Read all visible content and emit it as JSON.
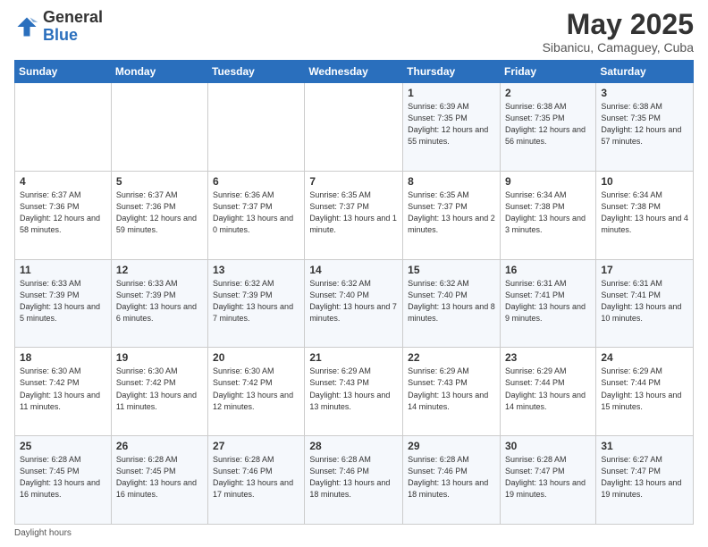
{
  "header": {
    "logo_general": "General",
    "logo_blue": "Blue",
    "month_title": "May 2025",
    "subtitle": "Sibanicu, Camaguey, Cuba"
  },
  "days_of_week": [
    "Sunday",
    "Monday",
    "Tuesday",
    "Wednesday",
    "Thursday",
    "Friday",
    "Saturday"
  ],
  "weeks": [
    [
      {
        "day": "",
        "info": ""
      },
      {
        "day": "",
        "info": ""
      },
      {
        "day": "",
        "info": ""
      },
      {
        "day": "",
        "info": ""
      },
      {
        "day": "1",
        "info": "Sunrise: 6:39 AM\nSunset: 7:35 PM\nDaylight: 12 hours and 55 minutes."
      },
      {
        "day": "2",
        "info": "Sunrise: 6:38 AM\nSunset: 7:35 PM\nDaylight: 12 hours and 56 minutes."
      },
      {
        "day": "3",
        "info": "Sunrise: 6:38 AM\nSunset: 7:35 PM\nDaylight: 12 hours and 57 minutes."
      }
    ],
    [
      {
        "day": "4",
        "info": "Sunrise: 6:37 AM\nSunset: 7:36 PM\nDaylight: 12 hours and 58 minutes."
      },
      {
        "day": "5",
        "info": "Sunrise: 6:37 AM\nSunset: 7:36 PM\nDaylight: 12 hours and 59 minutes."
      },
      {
        "day": "6",
        "info": "Sunrise: 6:36 AM\nSunset: 7:37 PM\nDaylight: 13 hours and 0 minutes."
      },
      {
        "day": "7",
        "info": "Sunrise: 6:35 AM\nSunset: 7:37 PM\nDaylight: 13 hours and 1 minute."
      },
      {
        "day": "8",
        "info": "Sunrise: 6:35 AM\nSunset: 7:37 PM\nDaylight: 13 hours and 2 minutes."
      },
      {
        "day": "9",
        "info": "Sunrise: 6:34 AM\nSunset: 7:38 PM\nDaylight: 13 hours and 3 minutes."
      },
      {
        "day": "10",
        "info": "Sunrise: 6:34 AM\nSunset: 7:38 PM\nDaylight: 13 hours and 4 minutes."
      }
    ],
    [
      {
        "day": "11",
        "info": "Sunrise: 6:33 AM\nSunset: 7:39 PM\nDaylight: 13 hours and 5 minutes."
      },
      {
        "day": "12",
        "info": "Sunrise: 6:33 AM\nSunset: 7:39 PM\nDaylight: 13 hours and 6 minutes."
      },
      {
        "day": "13",
        "info": "Sunrise: 6:32 AM\nSunset: 7:39 PM\nDaylight: 13 hours and 7 minutes."
      },
      {
        "day": "14",
        "info": "Sunrise: 6:32 AM\nSunset: 7:40 PM\nDaylight: 13 hours and 7 minutes."
      },
      {
        "day": "15",
        "info": "Sunrise: 6:32 AM\nSunset: 7:40 PM\nDaylight: 13 hours and 8 minutes."
      },
      {
        "day": "16",
        "info": "Sunrise: 6:31 AM\nSunset: 7:41 PM\nDaylight: 13 hours and 9 minutes."
      },
      {
        "day": "17",
        "info": "Sunrise: 6:31 AM\nSunset: 7:41 PM\nDaylight: 13 hours and 10 minutes."
      }
    ],
    [
      {
        "day": "18",
        "info": "Sunrise: 6:30 AM\nSunset: 7:42 PM\nDaylight: 13 hours and 11 minutes."
      },
      {
        "day": "19",
        "info": "Sunrise: 6:30 AM\nSunset: 7:42 PM\nDaylight: 13 hours and 11 minutes."
      },
      {
        "day": "20",
        "info": "Sunrise: 6:30 AM\nSunset: 7:42 PM\nDaylight: 13 hours and 12 minutes."
      },
      {
        "day": "21",
        "info": "Sunrise: 6:29 AM\nSunset: 7:43 PM\nDaylight: 13 hours and 13 minutes."
      },
      {
        "day": "22",
        "info": "Sunrise: 6:29 AM\nSunset: 7:43 PM\nDaylight: 13 hours and 14 minutes."
      },
      {
        "day": "23",
        "info": "Sunrise: 6:29 AM\nSunset: 7:44 PM\nDaylight: 13 hours and 14 minutes."
      },
      {
        "day": "24",
        "info": "Sunrise: 6:29 AM\nSunset: 7:44 PM\nDaylight: 13 hours and 15 minutes."
      }
    ],
    [
      {
        "day": "25",
        "info": "Sunrise: 6:28 AM\nSunset: 7:45 PM\nDaylight: 13 hours and 16 minutes."
      },
      {
        "day": "26",
        "info": "Sunrise: 6:28 AM\nSunset: 7:45 PM\nDaylight: 13 hours and 16 minutes."
      },
      {
        "day": "27",
        "info": "Sunrise: 6:28 AM\nSunset: 7:46 PM\nDaylight: 13 hours and 17 minutes."
      },
      {
        "day": "28",
        "info": "Sunrise: 6:28 AM\nSunset: 7:46 PM\nDaylight: 13 hours and 18 minutes."
      },
      {
        "day": "29",
        "info": "Sunrise: 6:28 AM\nSunset: 7:46 PM\nDaylight: 13 hours and 18 minutes."
      },
      {
        "day": "30",
        "info": "Sunrise: 6:28 AM\nSunset: 7:47 PM\nDaylight: 13 hours and 19 minutes."
      },
      {
        "day": "31",
        "info": "Sunrise: 6:27 AM\nSunset: 7:47 PM\nDaylight: 13 hours and 19 minutes."
      }
    ]
  ],
  "footer": {
    "note": "Daylight hours"
  }
}
